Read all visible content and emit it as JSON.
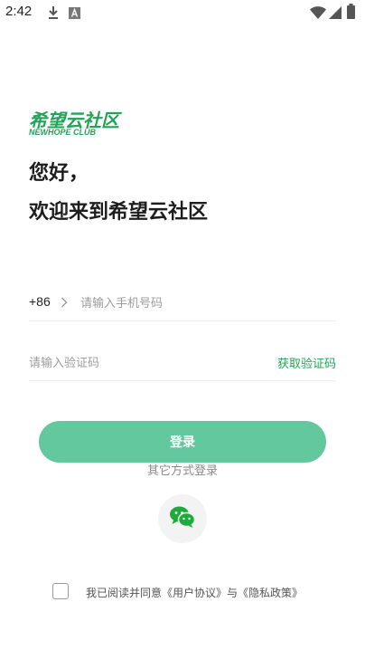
{
  "status_bar": {
    "time": "2:42",
    "icons": [
      "download-icon",
      "font-icon",
      "wifi-icon",
      "signal-icon",
      "battery-icon"
    ]
  },
  "brand": {
    "name_cn": "希望云社区",
    "name_en": "NEWHOPE CLUB",
    "color": "#20a456"
  },
  "greeting": {
    "line1": "您好，",
    "line2": "欢迎来到希望云社区"
  },
  "phone": {
    "country_code": "+86",
    "placeholder": "请输入手机号码",
    "value": ""
  },
  "verify": {
    "placeholder": "请输入验证码",
    "value": "",
    "get_code_label": "获取验证码"
  },
  "login": {
    "label": "登录",
    "color": "#64c89f"
  },
  "other_login": {
    "label": "其它方式登录",
    "methods": [
      "wechat-icon"
    ]
  },
  "agreement": {
    "checked": false,
    "prefix": "我已阅读并同意",
    "user_agreement": "《用户协议》",
    "conjunction": "与",
    "privacy_policy": "《隐私政策》"
  }
}
